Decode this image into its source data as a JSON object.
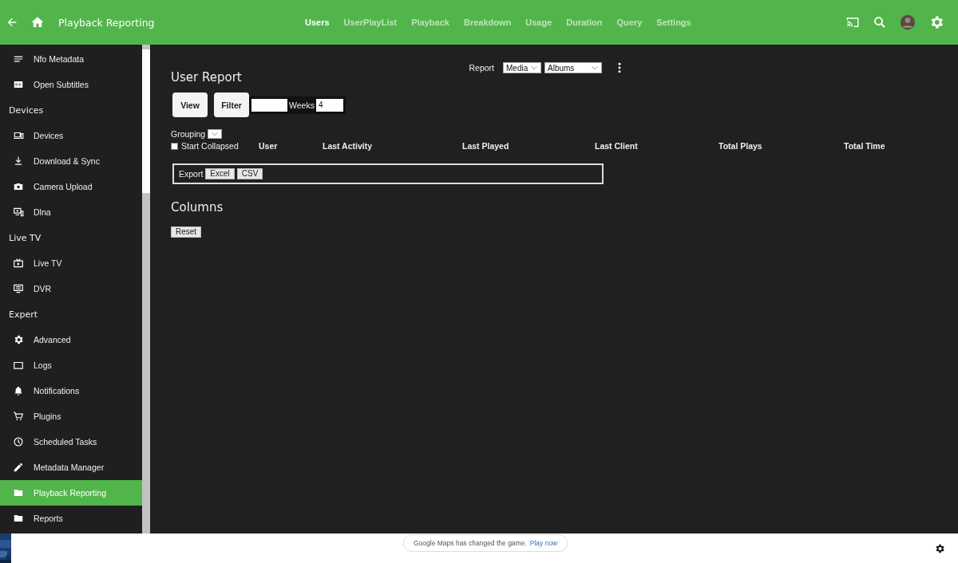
{
  "header": {
    "title": "Playback Reporting",
    "tabs": [
      {
        "label": "Users",
        "selected": true
      },
      {
        "label": "UserPlayList",
        "selected": false
      },
      {
        "label": "Playback",
        "selected": false
      },
      {
        "label": "Breakdown",
        "selected": false
      },
      {
        "label": "Usage",
        "selected": false
      },
      {
        "label": "Duration",
        "selected": false
      },
      {
        "label": "Query",
        "selected": false
      },
      {
        "label": "Settings",
        "selected": false
      }
    ]
  },
  "sidebar": {
    "sections": [
      {
        "items": [
          {
            "label": "Nfo Metadata",
            "selected": false
          },
          {
            "label": "Open Subtitles",
            "selected": false
          }
        ]
      },
      {
        "heading": "Devices",
        "items": [
          {
            "label": "Devices",
            "selected": false
          },
          {
            "label": "Download & Sync",
            "selected": false
          },
          {
            "label": "Camera Upload",
            "selected": false
          },
          {
            "label": "Dlna",
            "selected": false
          }
        ]
      },
      {
        "heading": "Live TV",
        "items": [
          {
            "label": "Live TV",
            "selected": false
          },
          {
            "label": "DVR",
            "selected": false
          }
        ]
      },
      {
        "heading": "Expert",
        "items": [
          {
            "label": "Advanced",
            "selected": false
          },
          {
            "label": "Logs",
            "selected": false
          },
          {
            "label": "Notifications",
            "selected": false
          },
          {
            "label": "Plugins",
            "selected": false
          },
          {
            "label": "Scheduled Tasks",
            "selected": false
          },
          {
            "label": "Metadata Manager",
            "selected": false
          },
          {
            "label": "Playback Reporting",
            "selected": true
          },
          {
            "label": "Reports",
            "selected": false
          }
        ]
      }
    ]
  },
  "report": {
    "title": "User Report",
    "report_label": "Report",
    "report_type": "Media",
    "report_subtype": "Albums",
    "view_button": "View",
    "filter_button": "Filter",
    "weeks_label": "Weeks",
    "weeks_value": "4",
    "grouping_label": "Grouping",
    "start_collapsed": {
      "label": "Start Collapsed",
      "checked": false
    },
    "columns": [
      "User",
      "Last Activity",
      "Last Played",
      "Last Client",
      "Total Plays",
      "Total Time"
    ],
    "export_label": "Export",
    "export_buttons": [
      "Excel",
      "CSV"
    ],
    "columns_heading": "Columns",
    "reset_button": "Reset"
  },
  "bottom_bar": {
    "message": "Google Maps has changed the game.",
    "link": "Play now"
  }
}
